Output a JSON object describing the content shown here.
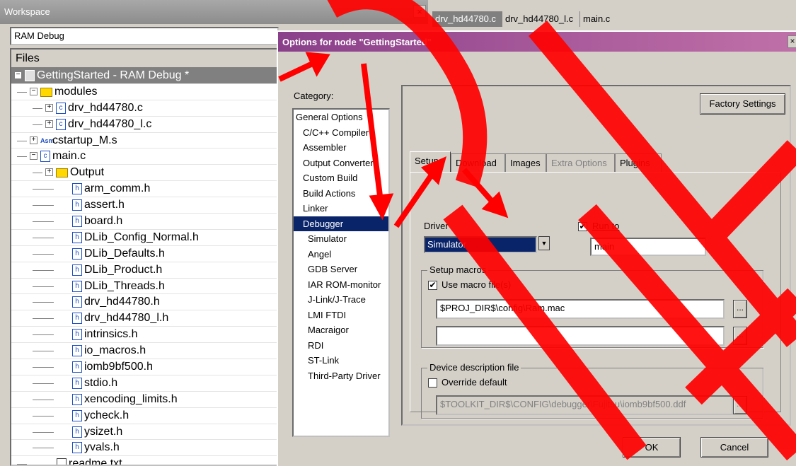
{
  "workspace": {
    "title": "Workspace",
    "close_glyph": "×",
    "config": "RAM Debug",
    "files_header": "Files"
  },
  "tree": [
    {
      "label": "GettingStarted - RAM Debug *",
      "icon": "project-icon",
      "root": true
    },
    {
      "label": "modules",
      "icon": "folder-icon"
    },
    {
      "label": "drv_hd44780.c",
      "icon": "c-file-icon"
    },
    {
      "label": "drv_hd44780_l.c",
      "icon": "c-file-icon"
    },
    {
      "label": "cstartup_M.s",
      "icon": "asm-file-icon"
    },
    {
      "label": "main.c",
      "icon": "c-file-icon"
    },
    {
      "label": "Output",
      "icon": "folder-icon"
    },
    {
      "label": "arm_comm.h",
      "icon": "h-file-icon"
    },
    {
      "label": "assert.h",
      "icon": "h-file-icon"
    },
    {
      "label": "board.h",
      "icon": "h-file-icon"
    },
    {
      "label": "DLib_Config_Normal.h",
      "icon": "h-file-icon"
    },
    {
      "label": "DLib_Defaults.h",
      "icon": "h-file-icon"
    },
    {
      "label": "DLib_Product.h",
      "icon": "h-file-icon"
    },
    {
      "label": "DLib_Threads.h",
      "icon": "h-file-icon"
    },
    {
      "label": "drv_hd44780.h",
      "icon": "h-file-icon"
    },
    {
      "label": "drv_hd44780_l.h",
      "icon": "h-file-icon"
    },
    {
      "label": "intrinsics.h",
      "icon": "h-file-icon"
    },
    {
      "label": "io_macros.h",
      "icon": "h-file-icon"
    },
    {
      "label": "iomb9bf500.h",
      "icon": "h-file-icon"
    },
    {
      "label": "stdio.h",
      "icon": "h-file-icon"
    },
    {
      "label": "xencoding_limits.h",
      "icon": "h-file-icon"
    },
    {
      "label": "ycheck.h",
      "icon": "h-file-icon"
    },
    {
      "label": "ysizet.h",
      "icon": "h-file-icon"
    },
    {
      "label": "yvals.h",
      "icon": "h-file-icon"
    },
    {
      "label": "readme.txt",
      "icon": "text-file-icon"
    }
  ],
  "editor_tabs": [
    "drv_hd44780.c",
    "drv_hd44780_l.c",
    "main.c"
  ],
  "dialog": {
    "title": "Options for node \"GettingStarted\"",
    "close_glyph": "×",
    "category_label": "Category:",
    "categories": [
      {
        "label": "General Options",
        "level": 0
      },
      {
        "label": "C/C++ Compiler",
        "level": 0
      },
      {
        "label": "Assembler",
        "level": 0
      },
      {
        "label": "Output Converter",
        "level": 0
      },
      {
        "label": "Custom Build",
        "level": 0
      },
      {
        "label": "Build Actions",
        "level": 0
      },
      {
        "label": "Linker",
        "level": 0
      },
      {
        "label": "Debugger",
        "level": 0,
        "selected": true
      },
      {
        "label": "Simulator",
        "level": 1
      },
      {
        "label": "Angel",
        "level": 1
      },
      {
        "label": "GDB Server",
        "level": 1
      },
      {
        "label": "IAR ROM-monitor",
        "level": 1
      },
      {
        "label": "J-Link/J-Trace",
        "level": 1
      },
      {
        "label": "LMI FTDI",
        "level": 1
      },
      {
        "label": "Macraigor",
        "level": 1
      },
      {
        "label": "RDI",
        "level": 1
      },
      {
        "label": "ST-Link",
        "level": 1
      },
      {
        "label": "Third-Party Driver",
        "level": 1
      }
    ],
    "factory_settings": "Factory Settings",
    "tabs": [
      {
        "label": "Setup",
        "active": true
      },
      {
        "label": "Download"
      },
      {
        "label": "Images"
      },
      {
        "label": "Extra Options",
        "disabled": true
      },
      {
        "label": "Plugins"
      }
    ],
    "setup": {
      "driver_label": "Driver",
      "driver_value": "Simulator",
      "run_to_label": "Run to",
      "run_to_checked": true,
      "run_to_value": "main",
      "setup_macros_label": "Setup macros",
      "use_macro_label": "Use macro file(s)",
      "use_macro_checked": true,
      "macro_file_1": "$PROJ_DIR$\\config\\Ram.mac",
      "macro_file_2": "",
      "browse_label": "...",
      "device_desc_label": "Device description file",
      "override_label": "Override default",
      "override_checked": false,
      "ddf_path": "$TOOLKIT_DIR$\\CONFIG\\debugger\\Fujitsu\\iomb9bf500.ddf"
    },
    "ok": "OK",
    "cancel": "Cancel"
  },
  "colors": {
    "annotation_red": "#ff0000",
    "selection": "#0a246a",
    "title_gradient_start": "#8a3f8a"
  }
}
